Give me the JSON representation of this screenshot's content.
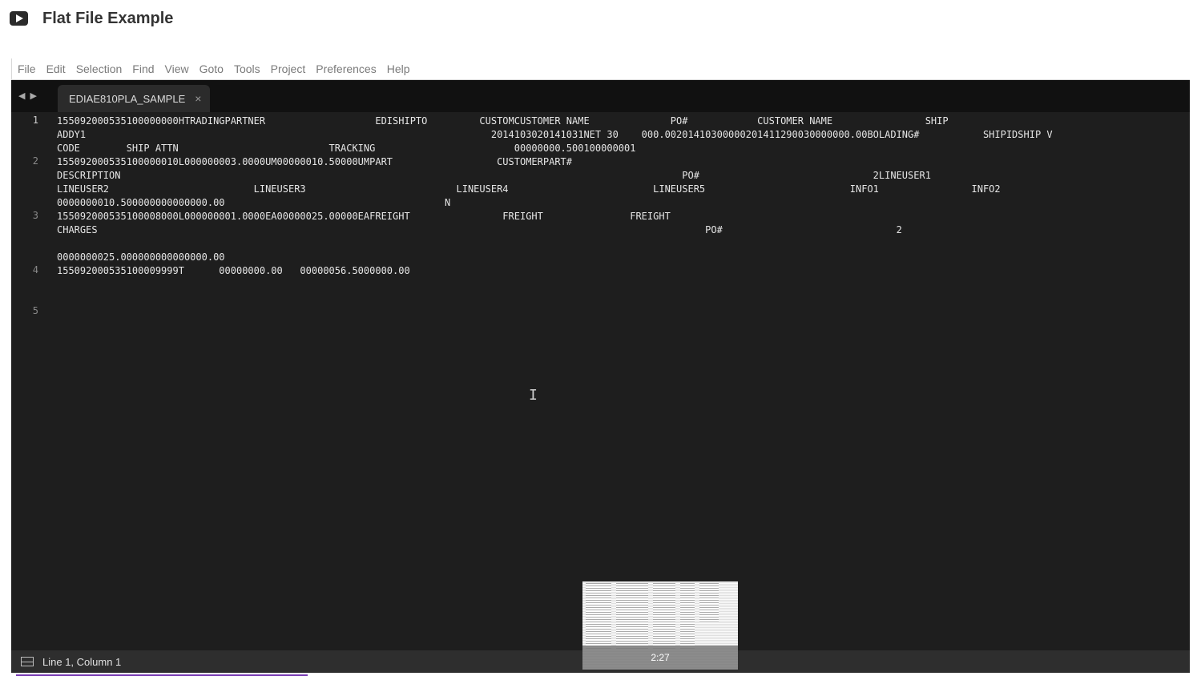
{
  "page": {
    "title": "Flat File Example",
    "icon": "video-play-icon"
  },
  "menu": [
    "File",
    "Edit",
    "Selection",
    "Find",
    "View",
    "Goto",
    "Tools",
    "Project",
    "Preferences",
    "Help"
  ],
  "tab": {
    "label": "EDIAE810PLA_SAMPLE",
    "close": "×"
  },
  "gutter": [
    "1",
    "2",
    "3",
    "4",
    "5"
  ],
  "code_lines": [
    "155092000535100000000HTRADINGPARTNER                   EDISHIPTO         CUSTOMCUSTOMER NAME              PO#            CUSTOMER NAME                SHIP                         ",
    "ADDY1                                                                      2014103020141031NET 30    000.00201410300000201411290030000000.00BOLADING#           SHIPIDSHIP V",
    "CODE        SHIP ATTN                          TRACKING                        00000000.500100000001",
    "155092000535100000010L000000003.0000UM00000010.50000UMPART                  CUSTOMERPART#",
    "DESCRIPTION                                                                                                 PO#                              2LINEUSER1",
    "LINEUSER2                         LINEUSER3                          LINEUSER4                         LINEUSER5                         INFO1                INFO2",
    "0000000010.500000000000000.00                                      N",
    "155092000535100008000L000000001.0000EA00000025.00000EAFREIGHT                FREIGHT               FREIGHT",
    "CHARGES                                                                                                         PO#                              2",
    "",
    "0000000025.000000000000000.00",
    "155092000535100009999T      00000000.00   00000056.5000000.00"
  ],
  "status": {
    "text": "Line 1, Column 1"
  },
  "thumbnail": {
    "time": "2:27"
  },
  "colors": {
    "editor_bg": "#1e1e1e",
    "tab_bg": "#2b2b2b",
    "status_bg": "#2e2e2e",
    "link_underline": "#7b3fb5"
  }
}
